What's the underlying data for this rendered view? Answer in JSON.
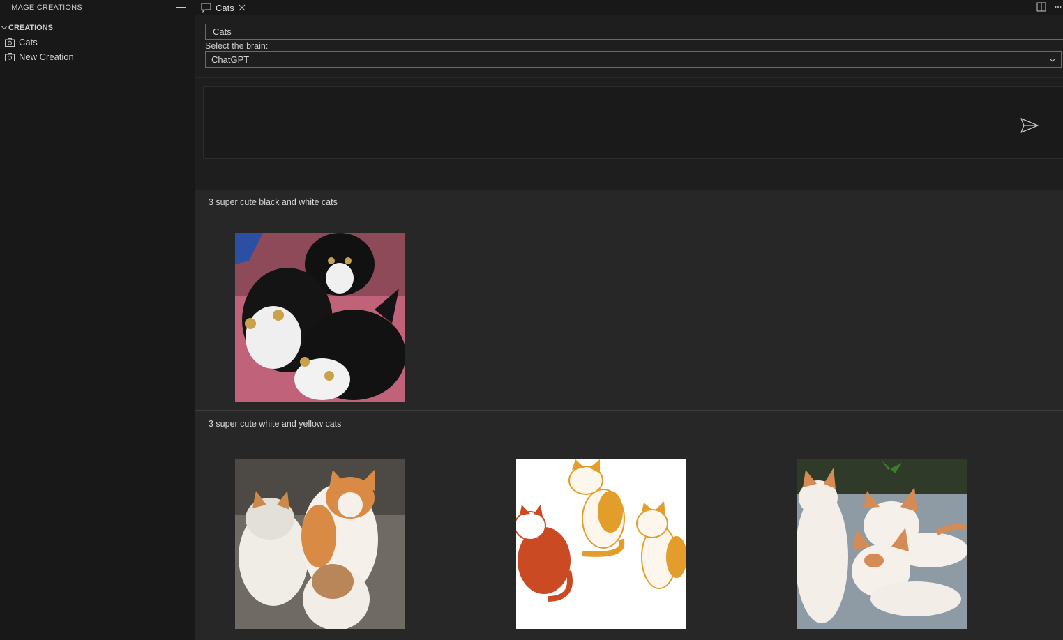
{
  "sidebar": {
    "title": "IMAGE CREATIONS",
    "section": "CREATIONS",
    "items": [
      {
        "label": "Cats",
        "icon": "camera-icon"
      },
      {
        "label": "New Creation",
        "icon": "camera-icon"
      }
    ]
  },
  "tabs": [
    {
      "label": "Cats",
      "icon": "chat-bubble-icon",
      "active": true
    }
  ],
  "editor": {
    "title_value": "Cats",
    "brain_label": "Select the brain:",
    "brain_selected": "ChatGPT",
    "prompt_value": ""
  },
  "results": [
    {
      "prompt": "3 super cute black and white cats",
      "images": [
        "black-and-white-cats-photo"
      ]
    },
    {
      "prompt": "3 super cute white and yellow cats",
      "images": [
        "orange-white-kittens-photo",
        "cartoon-orange-cats-illustration",
        "orange-white-kittens-on-tiles-photo"
      ]
    }
  ],
  "colors": {
    "background": "#1e1e1e",
    "sidebar": "#181818",
    "results_bg": "#272727",
    "border": "#6a6a6a"
  }
}
